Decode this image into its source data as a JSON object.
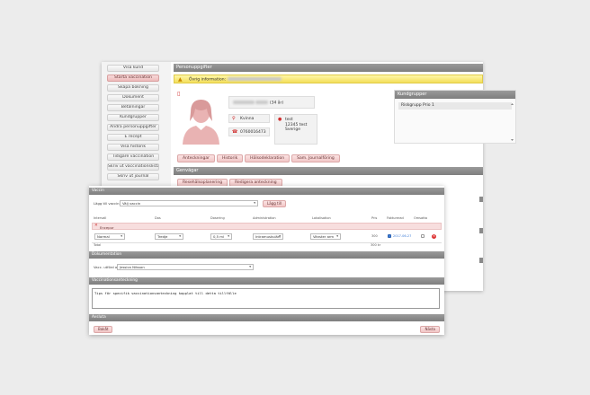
{
  "sidebar": {
    "items": [
      {
        "label": "Visa kund",
        "active": false
      },
      {
        "label": "Starta vaccination",
        "active": true
      },
      {
        "label": "Skapa bokning",
        "active": false
      },
      {
        "label": "Dokument",
        "active": false
      },
      {
        "label": "Betalningar",
        "active": false
      },
      {
        "label": "Kundgrupper",
        "active": false
      },
      {
        "label": "Ändra personuppgifter",
        "active": false
      },
      {
        "label": "E recept",
        "active": false
      },
      {
        "label": "Visa historik",
        "active": false
      },
      {
        "label": "Tidigare vaccination",
        "active": false
      },
      {
        "label": "Skriv ut vaccinationslista",
        "active": false
      },
      {
        "label": "Skriv ut journal",
        "active": false
      }
    ]
  },
  "person": {
    "header": "Personuppgifter",
    "warning_label": "Övrig information:",
    "age": "(34 år)",
    "gender": "Kvinna",
    "phone": "0760016473",
    "address_line1": "test",
    "address_line2": "12345 test",
    "address_line3": "Sverige",
    "buttons": [
      "Anteckningar",
      "Historik",
      "Hälsodeklaration",
      "Sam. Journalföring"
    ]
  },
  "kundgrupper": {
    "header": "Kundgrupper",
    "items": [
      "Riskgrupp Prio 1"
    ]
  },
  "genvagar": {
    "header": "Genvägar",
    "buttons": [
      "Resehälsoplanering",
      "Redigera anteckning"
    ]
  },
  "front": {
    "header": "Vaccin",
    "add_vaccine_label": "Lägg till vaccin",
    "add_vaccine_select": "Välj vaccin",
    "add_button": "Lägg till",
    "columns": [
      "Intervall",
      "Dos",
      "Dosering",
      "Administration",
      "Lokalisation",
      "Pris",
      "Fakturerad",
      "Omsatta"
    ],
    "vaccine_name": "Encepur",
    "row": {
      "interval": "Normal",
      "dose": "Tredje",
      "dosage": "0,5 ml",
      "administration": "Intramuskulärt",
      "localisation": "Vänster arm",
      "price": "300",
      "invoiced": "2017-06-27",
      "total_label": "Total",
      "total_value": "300 kr"
    },
    "doc_header": "Dokumentation",
    "performed_by_label": "Vacc. utförd av:",
    "performed_by_value": "Jessica Nilsson",
    "journal_header": "Vaccinationsanteckning",
    "journal_text": "Tips för specifik vaccinationsanteckning kopplat till detta tillfälle",
    "footer_header": "Avsluta",
    "back_button": "Bakåt",
    "next_button": "Nästa"
  },
  "colors": {
    "accent": "#f1c6c6",
    "header_grey": "#8a8a8a",
    "warning": "#f3de5a",
    "delete": "#dd3333"
  }
}
